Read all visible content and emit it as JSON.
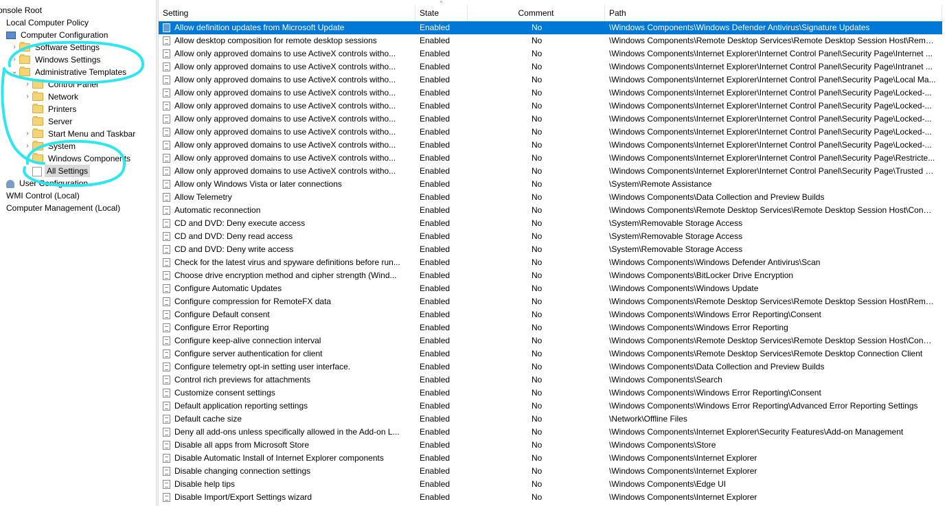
{
  "tree": {
    "nodes": [
      {
        "label": "onsole Root",
        "indent": 0,
        "twisty": "",
        "icon": "none"
      },
      {
        "label": "Local Computer Policy",
        "indent": 1,
        "twisty": "",
        "icon": "none"
      },
      {
        "label": "Computer Configuration",
        "indent": 2,
        "twisty": "",
        "icon": "pc"
      },
      {
        "label": "Software Settings",
        "indent": 3,
        "twisty": ">",
        "icon": "folder"
      },
      {
        "label": "Windows Settings",
        "indent": 3,
        "twisty": ">",
        "icon": "folder"
      },
      {
        "label": "Administrative Templates",
        "indent": 3,
        "twisty": "v",
        "icon": "folder"
      },
      {
        "label": "Control Panel",
        "indent": 4,
        "twisty": ">",
        "icon": "folder"
      },
      {
        "label": "Network",
        "indent": 4,
        "twisty": ">",
        "icon": "folder"
      },
      {
        "label": "Printers",
        "indent": 4,
        "twisty": "",
        "icon": "folder"
      },
      {
        "label": "Server",
        "indent": 4,
        "twisty": "",
        "icon": "folder"
      },
      {
        "label": "Start Menu and Taskbar",
        "indent": 4,
        "twisty": ">",
        "icon": "folder"
      },
      {
        "label": "System",
        "indent": 4,
        "twisty": ">",
        "icon": "folder"
      },
      {
        "label": "Windows Components",
        "indent": 4,
        "twisty": ">",
        "icon": "folder"
      },
      {
        "label": "All Settings",
        "indent": 4,
        "twisty": "",
        "icon": "settings",
        "selected": true
      },
      {
        "label": "User Configuration",
        "indent": 2,
        "twisty": "",
        "icon": "user"
      },
      {
        "label": "WMI Control (Local)",
        "indent": 1,
        "twisty": "",
        "icon": "none"
      },
      {
        "label": "Computer Management (Local)",
        "indent": 1,
        "twisty": "",
        "icon": "none"
      }
    ]
  },
  "columns": {
    "setting": "Setting",
    "state": "State",
    "comment": "Comment",
    "path": "Path",
    "sort_indicator": "^"
  },
  "rows": [
    {
      "setting": "Allow definition updates from Microsoft Update",
      "state": "Enabled",
      "comment": "No",
      "path": "\\Windows Components\\Windows Defender Antivirus\\Signature Updates",
      "selected": true
    },
    {
      "setting": "Allow desktop composition for remote desktop sessions",
      "state": "Enabled",
      "comment": "No",
      "path": "\\Windows Components\\Remote Desktop Services\\Remote Desktop Session Host\\Remot..."
    },
    {
      "setting": "Allow only approved domains to use ActiveX controls witho...",
      "state": "Enabled",
      "comment": "No",
      "path": "\\Windows Components\\Internet Explorer\\Internet Control Panel\\Security Page\\Internet ..."
    },
    {
      "setting": "Allow only approved domains to use ActiveX controls witho...",
      "state": "Enabled",
      "comment": "No",
      "path": "\\Windows Components\\Internet Explorer\\Internet Control Panel\\Security Page\\Intranet ..."
    },
    {
      "setting": "Allow only approved domains to use ActiveX controls witho...",
      "state": "Enabled",
      "comment": "No",
      "path": "\\Windows Components\\Internet Explorer\\Internet Control Panel\\Security Page\\Local Ma..."
    },
    {
      "setting": "Allow only approved domains to use ActiveX controls witho...",
      "state": "Enabled",
      "comment": "No",
      "path": "\\Windows Components\\Internet Explorer\\Internet Control Panel\\Security Page\\Locked-..."
    },
    {
      "setting": "Allow only approved domains to use ActiveX controls witho...",
      "state": "Enabled",
      "comment": "No",
      "path": "\\Windows Components\\Internet Explorer\\Internet Control Panel\\Security Page\\Locked-..."
    },
    {
      "setting": "Allow only approved domains to use ActiveX controls witho...",
      "state": "Enabled",
      "comment": "No",
      "path": "\\Windows Components\\Internet Explorer\\Internet Control Panel\\Security Page\\Locked-..."
    },
    {
      "setting": "Allow only approved domains to use ActiveX controls witho...",
      "state": "Enabled",
      "comment": "No",
      "path": "\\Windows Components\\Internet Explorer\\Internet Control Panel\\Security Page\\Locked-..."
    },
    {
      "setting": "Allow only approved domains to use ActiveX controls witho...",
      "state": "Enabled",
      "comment": "No",
      "path": "\\Windows Components\\Internet Explorer\\Internet Control Panel\\Security Page\\Locked-..."
    },
    {
      "setting": "Allow only approved domains to use ActiveX controls witho...",
      "state": "Enabled",
      "comment": "No",
      "path": "\\Windows Components\\Internet Explorer\\Internet Control Panel\\Security Page\\Restricte..."
    },
    {
      "setting": "Allow only approved domains to use ActiveX controls witho...",
      "state": "Enabled",
      "comment": "No",
      "path": "\\Windows Components\\Internet Explorer\\Internet Control Panel\\Security Page\\Trusted S..."
    },
    {
      "setting": "Allow only Windows Vista or later connections",
      "state": "Enabled",
      "comment": "No",
      "path": "\\System\\Remote Assistance"
    },
    {
      "setting": "Allow Telemetry",
      "state": "Enabled",
      "comment": "No",
      "path": "\\Windows Components\\Data Collection and Preview Builds"
    },
    {
      "setting": "Automatic reconnection",
      "state": "Enabled",
      "comment": "No",
      "path": "\\Windows Components\\Remote Desktop Services\\Remote Desktop Session Host\\Conne..."
    },
    {
      "setting": "CD and DVD: Deny execute access",
      "state": "Enabled",
      "comment": "No",
      "path": "\\System\\Removable Storage Access"
    },
    {
      "setting": "CD and DVD: Deny read access",
      "state": "Enabled",
      "comment": "No",
      "path": "\\System\\Removable Storage Access"
    },
    {
      "setting": "CD and DVD: Deny write access",
      "state": "Enabled",
      "comment": "No",
      "path": "\\System\\Removable Storage Access"
    },
    {
      "setting": "Check for the latest virus and spyware definitions before run...",
      "state": "Enabled",
      "comment": "No",
      "path": "\\Windows Components\\Windows Defender Antivirus\\Scan"
    },
    {
      "setting": "Choose drive encryption method and cipher strength (Wind...",
      "state": "Enabled",
      "comment": "No",
      "path": "\\Windows Components\\BitLocker Drive Encryption"
    },
    {
      "setting": "Configure Automatic Updates",
      "state": "Enabled",
      "comment": "No",
      "path": "\\Windows Components\\Windows Update"
    },
    {
      "setting": "Configure compression for RemoteFX data",
      "state": "Enabled",
      "comment": "No",
      "path": "\\Windows Components\\Remote Desktop Services\\Remote Desktop Session Host\\Remot..."
    },
    {
      "setting": "Configure Default consent",
      "state": "Enabled",
      "comment": "No",
      "path": "\\Windows Components\\Windows Error Reporting\\Consent"
    },
    {
      "setting": "Configure Error Reporting",
      "state": "Enabled",
      "comment": "No",
      "path": "\\Windows Components\\Windows Error Reporting"
    },
    {
      "setting": "Configure keep-alive connection interval",
      "state": "Enabled",
      "comment": "No",
      "path": "\\Windows Components\\Remote Desktop Services\\Remote Desktop Session Host\\Conne..."
    },
    {
      "setting": "Configure server authentication for client",
      "state": "Enabled",
      "comment": "No",
      "path": "\\Windows Components\\Remote Desktop Services\\Remote Desktop Connection Client"
    },
    {
      "setting": "Configure telemetry opt-in setting user interface.",
      "state": "Enabled",
      "comment": "No",
      "path": "\\Windows Components\\Data Collection and Preview Builds"
    },
    {
      "setting": "Control rich previews for attachments",
      "state": "Enabled",
      "comment": "No",
      "path": "\\Windows Components\\Search"
    },
    {
      "setting": "Customize consent settings",
      "state": "Enabled",
      "comment": "No",
      "path": "\\Windows Components\\Windows Error Reporting\\Consent"
    },
    {
      "setting": "Default application reporting settings",
      "state": "Enabled",
      "comment": "No",
      "path": "\\Windows Components\\Windows Error Reporting\\Advanced Error Reporting Settings"
    },
    {
      "setting": "Default cache size",
      "state": "Enabled",
      "comment": "No",
      "path": "\\Network\\Offline Files"
    },
    {
      "setting": "Deny all add-ons unless specifically allowed in the Add-on L...",
      "state": "Enabled",
      "comment": "No",
      "path": "\\Windows Components\\Internet Explorer\\Security Features\\Add-on Management"
    },
    {
      "setting": "Disable all apps from Microsoft Store",
      "state": "Enabled",
      "comment": "No",
      "path": "\\Windows Components\\Store"
    },
    {
      "setting": "Disable Automatic Install of Internet Explorer components",
      "state": "Enabled",
      "comment": "No",
      "path": "\\Windows Components\\Internet Explorer"
    },
    {
      "setting": "Disable changing connection settings",
      "state": "Enabled",
      "comment": "No",
      "path": "\\Windows Components\\Internet Explorer"
    },
    {
      "setting": "Disable help tips",
      "state": "Enabled",
      "comment": "No",
      "path": "\\Windows Components\\Edge UI"
    },
    {
      "setting": "Disable Import/Export Settings wizard",
      "state": "Enabled",
      "comment": "No",
      "path": "\\Windows Components\\Internet Explorer"
    }
  ],
  "colors": {
    "selection": "#0078d7",
    "annotation": "#2ee6f0"
  }
}
